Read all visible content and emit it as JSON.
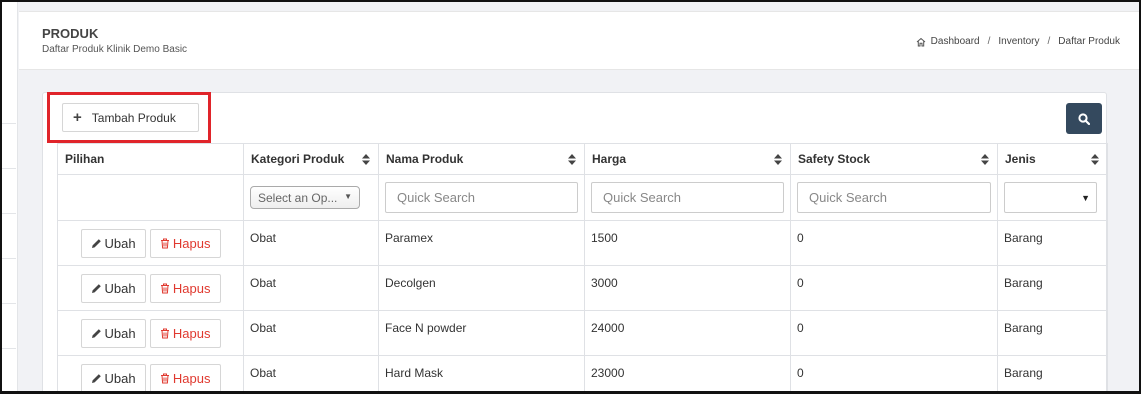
{
  "header": {
    "title": "PRODUK",
    "subtitle": "Daftar Produk Klinik Demo Basic",
    "breadcrumb": [
      "Dashboard",
      "Inventory",
      "Daftar Produk"
    ]
  },
  "toolbar": {
    "add_label": "Tambah Produk",
    "search_icon": "search-icon"
  },
  "table": {
    "columns": [
      "Pilihan",
      "Kategori Produk",
      "Nama Produk",
      "Harga",
      "Safety Stock",
      "Jenis"
    ],
    "filters": {
      "category_placeholder": "Select an Op...",
      "quick_search_placeholder": "Quick Search"
    },
    "row_actions": {
      "edit_label": "Ubah",
      "delete_label": "Hapus"
    },
    "rows": [
      [
        "Obat",
        "Paramex",
        "1500",
        "0",
        "Barang"
      ],
      [
        "Obat",
        "Decolgen",
        "3000",
        "0",
        "Barang"
      ],
      [
        "Obat",
        "Face N powder",
        "24000",
        "0",
        "Barang"
      ],
      [
        "Obat",
        "Hard Mask",
        "23000",
        "0",
        "Barang"
      ]
    ]
  },
  "colors": {
    "accent": "#34495e",
    "danger": "#e0392f",
    "highlight": "#e0242a"
  }
}
